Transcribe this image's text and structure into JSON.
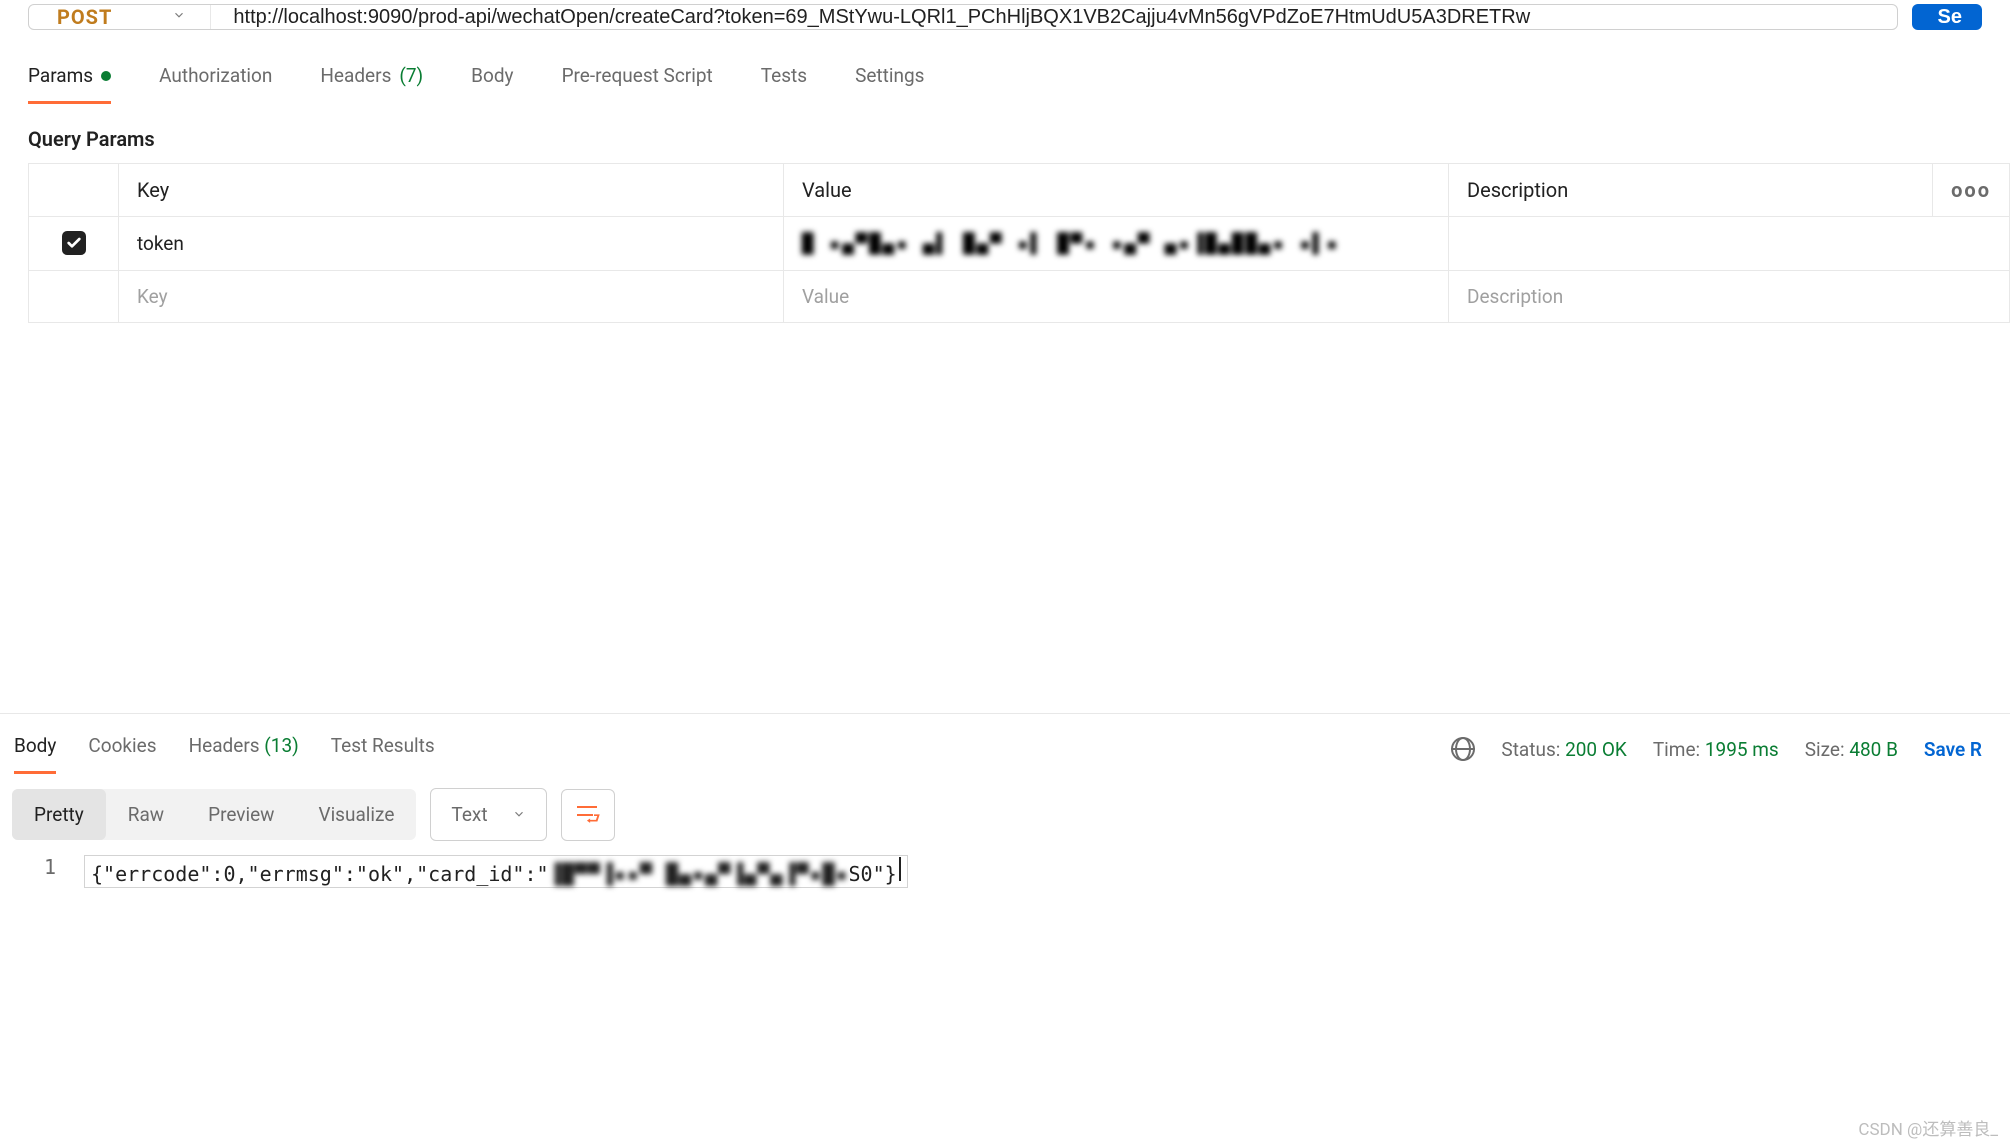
{
  "request": {
    "method": "POST",
    "url": "http://localhost:9090/prod-api/wechatOpen/createCard?token=69_MStYwu-LQRl1_PChHljBQX1VB2Cajju4vMn56gVPdZoE7HtmUdU5A3DRETRw",
    "send_label": "Se"
  },
  "tabs": {
    "params": "Params",
    "authorization": "Authorization",
    "headers_label": "Headers",
    "headers_count": "(7)",
    "body": "Body",
    "prerequest": "Pre-request Script",
    "tests": "Tests",
    "settings": "Settings"
  },
  "query_params": {
    "title": "Query Params",
    "columns": {
      "key": "Key",
      "value": "Value",
      "description": "Description"
    },
    "rows": [
      {
        "enabled": true,
        "key": "token",
        "value": "█ ▪▄▀█▄▪  ▄▌  █▄▀ ▪▌ █▀▪ ▪▄▀ ▄▪▐█▄██▄▪  ▪▌▪",
        "description": ""
      }
    ],
    "placeholders": {
      "key": "Key",
      "value": "Value",
      "description": "Description"
    }
  },
  "response": {
    "tabs": {
      "body": "Body",
      "cookies": "Cookies",
      "headers_label": "Headers",
      "headers_count": "(13)",
      "test_results": "Test Results"
    },
    "status": {
      "status_label": "Status:",
      "status_value": "200 OK",
      "time_label": "Time:",
      "time_value": "1995 ms",
      "size_label": "Size:",
      "size_value": "480 B",
      "save_label": "Save R"
    },
    "view_modes": {
      "pretty": "Pretty",
      "raw": "Raw",
      "preview": "Preview",
      "visualize": "Visualize"
    },
    "type_label": "Text",
    "body": {
      "line_no": "1",
      "prefix": "{\"errcode\":0,\"errmsg\":\"ok\",\"card_id\":\"",
      "masked": "▐█▀▀▐▪▪▀  █▄▪▄▀▐▄▀▄▐▀▪█▪",
      "suffix": " S0\"}"
    }
  },
  "watermark": "CSDN @还算善良_"
}
